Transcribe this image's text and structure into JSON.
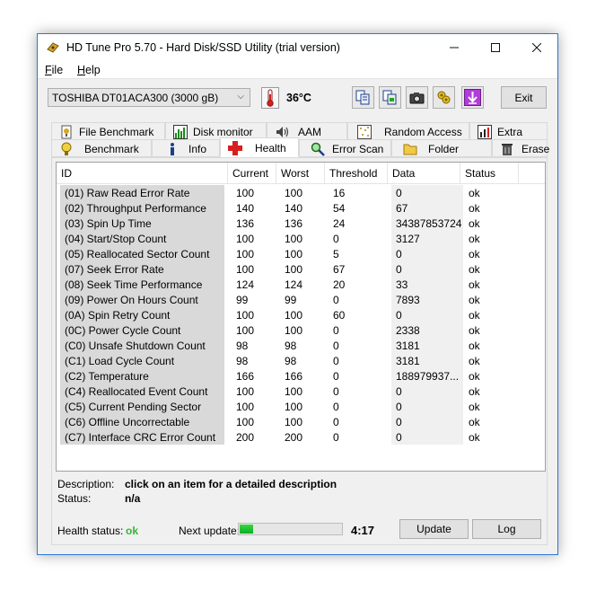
{
  "window": {
    "title": "HD Tune Pro 5.70 - Hard Disk/SSD Utility (trial version)"
  },
  "menu": {
    "file": "File",
    "help": "Help"
  },
  "toolbar": {
    "drive": "TOSHIBA DT01ACA300 (3000 gB)",
    "temperature": "36°C",
    "exit_label": "Exit",
    "buttons": [
      "copy-info-icon",
      "copy-screen-icon",
      "screenshot-camera-icon",
      "options-icon",
      "save-down-arrow-icon"
    ]
  },
  "tabs": {
    "top": [
      "File Benchmark",
      "Disk monitor",
      "AAM",
      "Random Access",
      "Extra tests"
    ],
    "bottom": [
      "Benchmark",
      "Info",
      "Health",
      "Error Scan",
      "Folder Usage",
      "Erase"
    ],
    "active": "Health"
  },
  "health_table": {
    "columns": [
      "ID",
      "Current",
      "Worst",
      "Threshold",
      "Data",
      "Status"
    ],
    "rows": [
      [
        "(01) Raw Read Error Rate",
        "100",
        "100",
        "16",
        "0",
        "ok"
      ],
      [
        "(02) Throughput Performance",
        "140",
        "140",
        "54",
        "67",
        "ok"
      ],
      [
        "(03) Spin Up Time",
        "136",
        "136",
        "24",
        "34387853724",
        "ok"
      ],
      [
        "(04) Start/Stop Count",
        "100",
        "100",
        "0",
        "3127",
        "ok"
      ],
      [
        "(05) Reallocated Sector Count",
        "100",
        "100",
        "5",
        "0",
        "ok"
      ],
      [
        "(07) Seek Error Rate",
        "100",
        "100",
        "67",
        "0",
        "ok"
      ],
      [
        "(08) Seek Time Performance",
        "124",
        "124",
        "20",
        "33",
        "ok"
      ],
      [
        "(09) Power On Hours Count",
        "99",
        "99",
        "0",
        "7893",
        "ok"
      ],
      [
        "(0A) Spin Retry Count",
        "100",
        "100",
        "60",
        "0",
        "ok"
      ],
      [
        "(0C) Power Cycle Count",
        "100",
        "100",
        "0",
        "2338",
        "ok"
      ],
      [
        "(C0) Unsafe Shutdown Count",
        "98",
        "98",
        "0",
        "3181",
        "ok"
      ],
      [
        "(C1) Load Cycle Count",
        "98",
        "98",
        "0",
        "3181",
        "ok"
      ],
      [
        "(C2) Temperature",
        "166",
        "166",
        "0",
        "188979937...",
        "ok"
      ],
      [
        "(C4) Reallocated Event Count",
        "100",
        "100",
        "0",
        "0",
        "ok"
      ],
      [
        "(C5) Current Pending Sector",
        "100",
        "100",
        "0",
        "0",
        "ok"
      ],
      [
        "(C6) Offline Uncorrectable",
        "100",
        "100",
        "0",
        "0",
        "ok"
      ],
      [
        "(C7) Interface CRC Error Count",
        "200",
        "200",
        "0",
        "0",
        "ok"
      ]
    ]
  },
  "description": {
    "description_label": "Description:",
    "description_value": "click on an item for a detailed description",
    "status_label": "Status:",
    "status_value": "n/a"
  },
  "footer": {
    "health_status_label": "Health status:",
    "health_status_value": "ok",
    "health_status_color": "#2fb82f",
    "next_update_label": "Next update:",
    "next_update_progress": 0.13,
    "countdown": "4:17",
    "update_label": "Update",
    "log_label": "Log"
  }
}
